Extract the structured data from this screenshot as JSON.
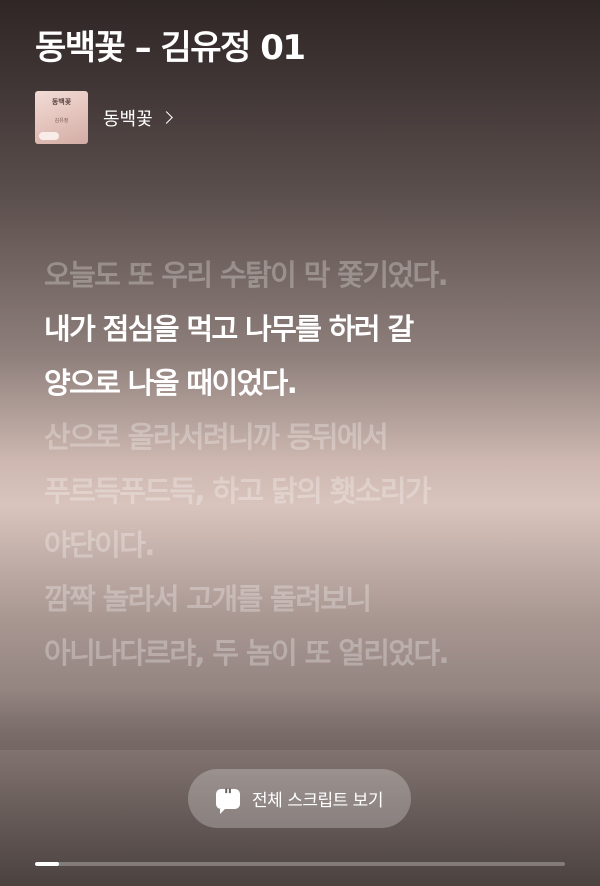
{
  "header": {
    "title": "동백꽃 – 김유정 01"
  },
  "album": {
    "thumb_title": "동백꽃",
    "thumb_sub": "김유정",
    "name": "동백꽃"
  },
  "lyrics": [
    {
      "text": "오늘도 또 우리 수탉이 막 쫓기었다.",
      "state": "dim"
    },
    {
      "text": "내가 점심을 먹고 나무를 하러 갈",
      "state": "active"
    },
    {
      "text": "양으로 나올 때이었다.",
      "state": "active"
    },
    {
      "text": "산으로 올라서려니까 등뒤에서",
      "state": "dim"
    },
    {
      "text": "푸르득푸드득, 하고 닭의 횃소리가",
      "state": "dim"
    },
    {
      "text": "야단이다.",
      "state": "dim"
    },
    {
      "text": "깜짝 놀라서 고개를 돌려보니",
      "state": "dim"
    },
    {
      "text": "아니나다르랴, 두 놈이 또 얼리었다.",
      "state": "dim"
    }
  ],
  "script_button": {
    "label": "전체 스크립트 보기",
    "icon": "quote-bubble-icon"
  },
  "progress": {
    "fraction": 0.045
  },
  "colors": {
    "text": "#ffffff",
    "button_bg": "rgba(255,255,255,0.25)"
  }
}
